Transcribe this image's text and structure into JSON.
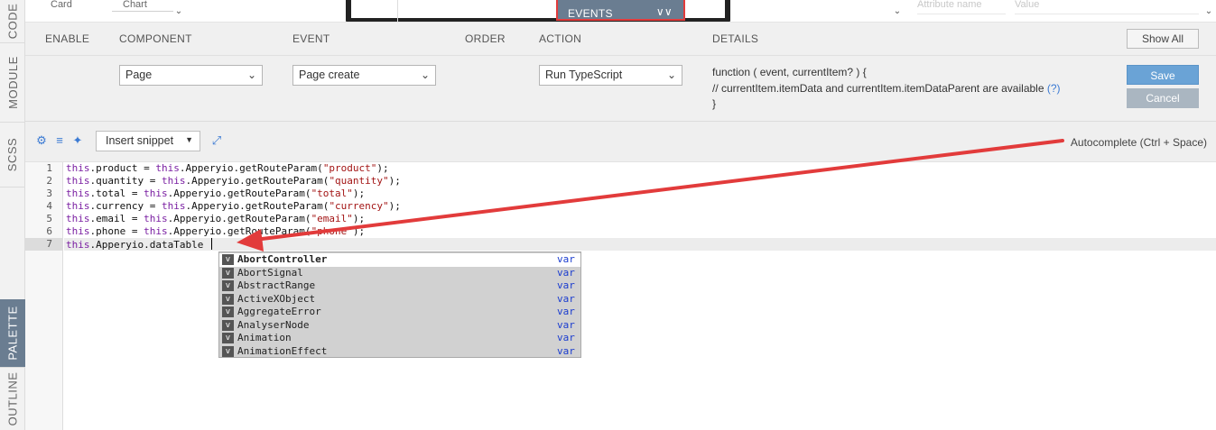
{
  "rail": {
    "tabs": [
      "CODE",
      "MODULE",
      "SCSS",
      "PALETTE",
      "OUTLINE"
    ],
    "active": "PALETTE"
  },
  "top": {
    "components": [
      "Card",
      "Chart"
    ],
    "events_tab": "EVENTS",
    "attr_name_placeholder": "Attribute name",
    "value_placeholder": "Value"
  },
  "events": {
    "columns": [
      "ENABLE",
      "COMPONENT",
      "EVENT",
      "ORDER",
      "ACTION",
      "DETAILS"
    ],
    "show_all": "Show All",
    "row": {
      "component": "Page",
      "event": "Page create",
      "action": "Run TypeScript",
      "details_line1": "function ( event, currentItem? ) {",
      "details_line2": "// currentItem.itemData and currentItem.itemDataParent are available",
      "details_help": "(?)",
      "details_line3": "}",
      "save": "Save",
      "cancel": "Cancel"
    }
  },
  "toolbar": {
    "snippet_label": "Insert snippet",
    "autocomplete_hint": "Autocomplete (Ctrl + Space)"
  },
  "editor": {
    "lines": [
      {
        "num": "1",
        "prefix": "this",
        "mid": ".product = ",
        "kw2": "this",
        "rest": ".Apperyio.getRouteParam(",
        "str": "\"product\"",
        "tail": ");"
      },
      {
        "num": "2",
        "prefix": "this",
        "mid": ".quantity = ",
        "kw2": "this",
        "rest": ".Apperyio.getRouteParam(",
        "str": "\"quantity\"",
        "tail": ");"
      },
      {
        "num": "3",
        "prefix": "this",
        "mid": ".total = ",
        "kw2": "this",
        "rest": ".Apperyio.getRouteParam(",
        "str": "\"total\"",
        "tail": ");"
      },
      {
        "num": "4",
        "prefix": "this",
        "mid": ".currency = ",
        "kw2": "this",
        "rest": ".Apperyio.getRouteParam(",
        "str": "\"currency\"",
        "tail": ");"
      },
      {
        "num": "5",
        "prefix": "this",
        "mid": ".email = ",
        "kw2": "this",
        "rest": ".Apperyio.getRouteParam(",
        "str": "\"email\"",
        "tail": ");"
      },
      {
        "num": "6",
        "prefix": "this",
        "mid": ".phone = ",
        "kw2": "this",
        "rest": ".Apperyio.getRouteParam(",
        "str": "\"phone\"",
        "tail": ");"
      },
      {
        "num": "7",
        "prefix": "this",
        "mid": ".Apperyio.dataTable ",
        "kw2": "",
        "rest": "",
        "str": "",
        "tail": ""
      }
    ]
  },
  "autocomplete": {
    "items": [
      {
        "name": "AbortController",
        "type": "var",
        "selected": true
      },
      {
        "name": "AbortSignal",
        "type": "var"
      },
      {
        "name": "AbstractRange",
        "type": "var"
      },
      {
        "name": "ActiveXObject",
        "type": "var"
      },
      {
        "name": "AggregateError",
        "type": "var"
      },
      {
        "name": "AnalyserNode",
        "type": "var"
      },
      {
        "name": "Animation",
        "type": "var"
      },
      {
        "name": "AnimationEffect",
        "type": "var"
      }
    ],
    "badge": "v"
  },
  "colors": {
    "annotation_red": "#e23b3b",
    "tab_active": "#6a7d91",
    "save_blue": "#6aa3d6"
  }
}
